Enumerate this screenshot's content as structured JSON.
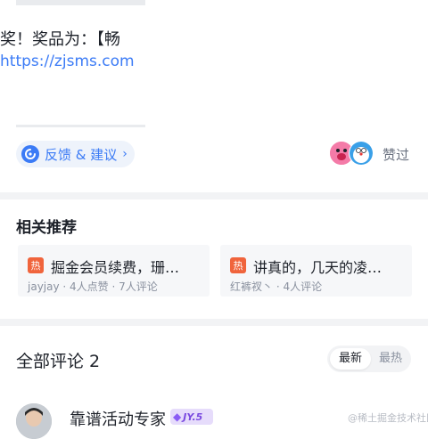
{
  "article": {
    "snippet_line": "奖！奖品为：【畅",
    "snippet_link": "https://zjsms.com"
  },
  "feedback": {
    "label": "反馈 & 建议",
    "chevron": "›",
    "icon": "feedback-icon"
  },
  "likes": {
    "label": "赞过"
  },
  "related": {
    "title": "相关推荐",
    "items": [
      {
        "badge": "热",
        "title": "掘金会员续费，珊…",
        "meta": "jayjay · 4人点赞 · 7人评论"
      },
      {
        "badge": "热",
        "title": "讲真的，几天的凌…",
        "meta": "红裤衩丶 · 4人评论"
      }
    ]
  },
  "comments": {
    "title": "全部评论 2",
    "sort_options": [
      "最新",
      "最热"
    ],
    "first": {
      "username": "靠谱活动专家",
      "level": "JY.5"
    }
  },
  "watermark": "@稀土掘金技术社区",
  "colors": {
    "accent": "#3b7bf6",
    "hot": "#f0643c",
    "divider": "#f2f3f5"
  }
}
